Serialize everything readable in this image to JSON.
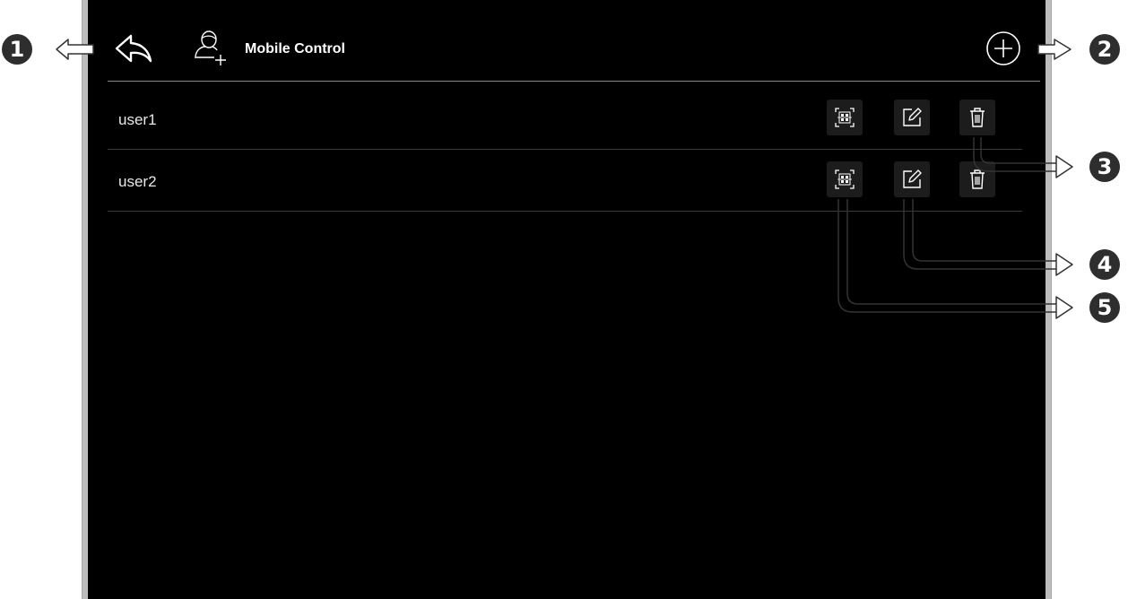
{
  "header": {
    "title": "Mobile Control",
    "back_icon": "back-arrow-icon",
    "title_icon": "user-add-icon",
    "add_icon": "plus-circle-icon"
  },
  "users": [
    {
      "name": "user1"
    },
    {
      "name": "user2"
    }
  ],
  "row_actions": {
    "icons": [
      "qr-code-icon",
      "edit-icon",
      "trash-icon"
    ]
  },
  "callouts": [
    "1",
    "2",
    "3",
    "4",
    "5"
  ],
  "colors": {
    "screen_bg": "#000000",
    "text": "#ffffff",
    "button_bg": "#1c1c1c",
    "callout_bg": "#2e2e2e",
    "bezel": "#bdbdbd"
  }
}
